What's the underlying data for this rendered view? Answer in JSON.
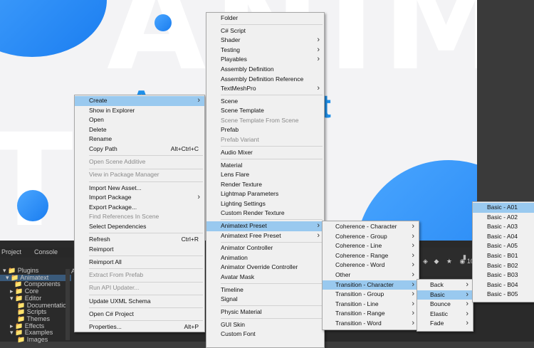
{
  "scene": {
    "bg_letters": "ANIM",
    "bg_letters2": "T",
    "title_partial": "A",
    "title_partial2": "xt"
  },
  "editor": {
    "tab_project": "Project",
    "tab_console": "Console",
    "tree_items": [
      "Plugins",
      "Animatext",
      "Components",
      "Core",
      "Editor",
      "Documentation",
      "Scripts",
      "Themes",
      "Effects",
      "Examples",
      "Images"
    ],
    "side_letter": "A",
    "count": "10"
  },
  "context_menu": [
    {
      "label": "Create",
      "arrow": true,
      "hl": true
    },
    {
      "label": "Show in Explorer"
    },
    {
      "label": "Open"
    },
    {
      "label": "Delete"
    },
    {
      "label": "Rename"
    },
    {
      "label": "Copy Path",
      "shortcut": "Alt+Ctrl+C"
    },
    {
      "sep": true
    },
    {
      "label": "Open Scene Additive",
      "dis": true
    },
    {
      "sep": true
    },
    {
      "label": "View in Package Manager",
      "dis": true
    },
    {
      "sep": true
    },
    {
      "label": "Import New Asset..."
    },
    {
      "label": "Import Package",
      "arrow": true
    },
    {
      "label": "Export Package..."
    },
    {
      "label": "Find References In Scene",
      "dis": true
    },
    {
      "label": "Select Dependencies"
    },
    {
      "sep": true
    },
    {
      "label": "Refresh",
      "shortcut": "Ctrl+R"
    },
    {
      "label": "Reimport"
    },
    {
      "sep": true
    },
    {
      "label": "Reimport All"
    },
    {
      "sep": true
    },
    {
      "label": "Extract From Prefab",
      "dis": true
    },
    {
      "sep": true
    },
    {
      "label": "Run API Updater...",
      "dis": true
    },
    {
      "sep": true
    },
    {
      "label": "Update UXML Schema"
    },
    {
      "sep": true
    },
    {
      "label": "Open C# Project"
    },
    {
      "sep": true
    },
    {
      "label": "Properties...",
      "shortcut": "Alt+P"
    }
  ],
  "create_menu": [
    {
      "label": "Folder"
    },
    {
      "sep": true
    },
    {
      "label": "C# Script"
    },
    {
      "label": "Shader",
      "arrow": true
    },
    {
      "label": "Testing",
      "arrow": true
    },
    {
      "label": "Playables",
      "arrow": true
    },
    {
      "label": "Assembly Definition"
    },
    {
      "label": "Assembly Definition Reference"
    },
    {
      "label": "TextMeshPro",
      "arrow": true
    },
    {
      "sep": true
    },
    {
      "label": "Scene"
    },
    {
      "label": "Scene Template"
    },
    {
      "label": "Scene Template From Scene",
      "dis": true
    },
    {
      "label": "Prefab"
    },
    {
      "label": "Prefab Variant",
      "dis": true
    },
    {
      "sep": true
    },
    {
      "label": "Audio Mixer"
    },
    {
      "sep": true
    },
    {
      "label": "Material"
    },
    {
      "label": "Lens Flare"
    },
    {
      "label": "Render Texture"
    },
    {
      "label": "Lightmap Parameters"
    },
    {
      "label": "Lighting Settings"
    },
    {
      "label": "Custom Render Texture"
    },
    {
      "sep": true
    },
    {
      "label": "Animatext Preset",
      "arrow": true,
      "hl": true
    },
    {
      "label": "Animatext Free Preset",
      "arrow": true
    },
    {
      "sep": true
    },
    {
      "label": "Animator Controller"
    },
    {
      "label": "Animation"
    },
    {
      "label": "Animator Override Controller"
    },
    {
      "label": "Avatar Mask"
    },
    {
      "sep": true
    },
    {
      "label": "Timeline"
    },
    {
      "label": "Signal"
    },
    {
      "sep": true
    },
    {
      "label": "Physic Material"
    },
    {
      "sep": true
    },
    {
      "label": "GUI Skin"
    },
    {
      "label": "Custom Font"
    }
  ],
  "preset_menu": [
    {
      "label": "Coherence - Character",
      "arrow": true
    },
    {
      "label": "Coherence - Group",
      "arrow": true
    },
    {
      "label": "Coherence - Line",
      "arrow": true
    },
    {
      "label": "Coherence - Range",
      "arrow": true
    },
    {
      "label": "Coherence - Word",
      "arrow": true
    },
    {
      "label": "Other",
      "arrow": true
    },
    {
      "label": "Transition - Character",
      "arrow": true,
      "hl": true
    },
    {
      "label": "Transition - Group",
      "arrow": true
    },
    {
      "label": "Transition - Line",
      "arrow": true
    },
    {
      "label": "Transition - Range",
      "arrow": true
    },
    {
      "label": "Transition - Word",
      "arrow": true
    }
  ],
  "transition_menu": [
    {
      "label": "Back",
      "arrow": true
    },
    {
      "label": "Basic",
      "arrow": true,
      "hl": true
    },
    {
      "label": "Bounce",
      "arrow": true
    },
    {
      "label": "Elastic",
      "arrow": true
    },
    {
      "label": "Fade",
      "arrow": true
    }
  ],
  "basic_menu": [
    {
      "label": "Basic - A01",
      "hl": true
    },
    {
      "label": "Basic - A02"
    },
    {
      "label": "Basic - A03"
    },
    {
      "label": "Basic - A04"
    },
    {
      "label": "Basic - A05"
    },
    {
      "label": "Basic - B01"
    },
    {
      "label": "Basic - B02"
    },
    {
      "label": "Basic - B03"
    },
    {
      "label": "Basic - B04"
    },
    {
      "label": "Basic - B05"
    }
  ]
}
